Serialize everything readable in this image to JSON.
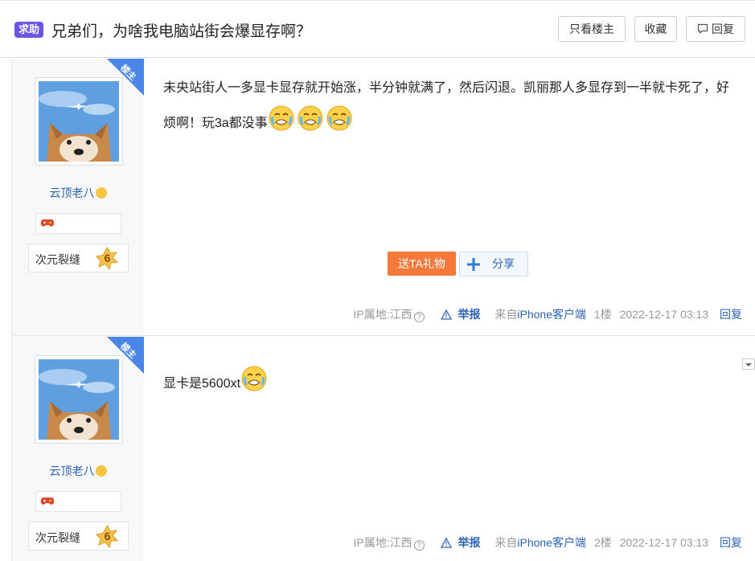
{
  "header": {
    "badge": "求助",
    "title": "兄弟们，为啥我电脑站街会爆显存啊？",
    "only_op": "只看楼主",
    "favorite": "收藏",
    "reply": "回复"
  },
  "posts": [
    {
      "op_tag": "楼主",
      "username": "云顶老八",
      "level_name": "次元裂缝",
      "level": "6",
      "content": "未央站街人一多显卡显存就开始涨，半分钟就满了，然后闪退。凯丽那人多显存到一半就卡死了，好烦啊！玩3a都没事",
      "emoji_count": 3,
      "gift": "送TA礼物",
      "share": "分享",
      "ip": "IP属地:江西",
      "report": "举报",
      "client_prefix": "来自",
      "client": "iPhone客户端",
      "floor": "1楼",
      "time": "2022-12-17 03:13",
      "reply": "回复"
    },
    {
      "op_tag": "楼主",
      "username": "云顶老八",
      "level_name": "次元裂缝",
      "level": "6",
      "content": "显卡是5600xt",
      "emoji_count": 1,
      "ip": "IP属地:江西",
      "report": "举报",
      "client_prefix": "来自",
      "client": "iPhone客户端",
      "floor": "2楼",
      "time": "2022-12-17 03:13",
      "reply": "回复"
    }
  ],
  "colors": {
    "badge": "#6c54e6",
    "link": "#2d64b3",
    "gift": "#f5793a",
    "op_tag": "#4a86e8"
  }
}
